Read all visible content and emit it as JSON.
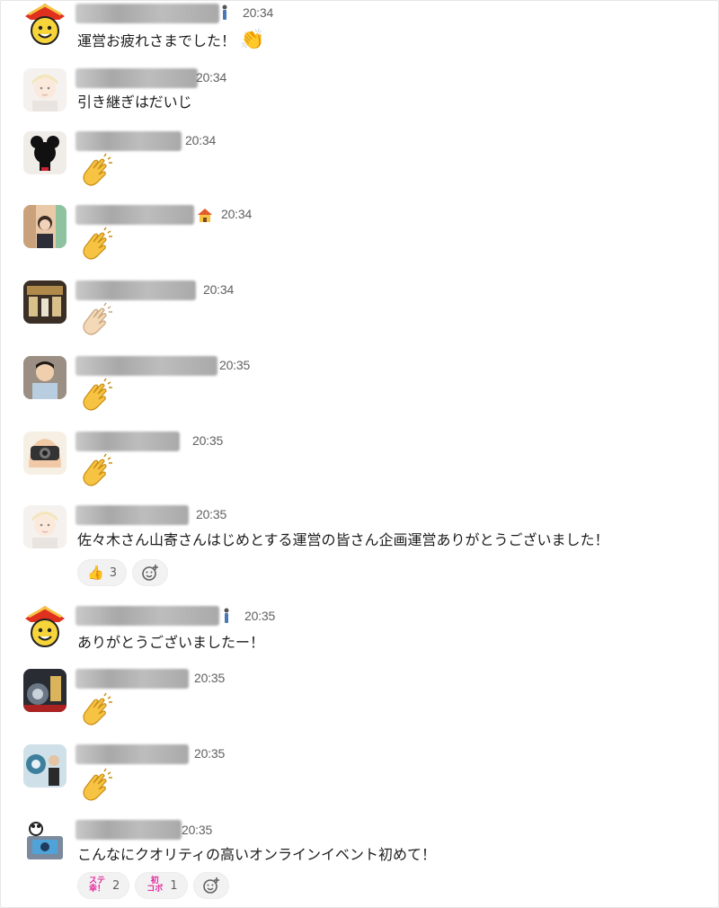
{
  "messages": [
    {
      "time": "20:34",
      "text": "運営お疲れさまでした！",
      "badge": "person-standing-icon"
    },
    {
      "time": "20:34",
      "text": "引き継ぎはだいじ"
    },
    {
      "time": "20:34",
      "emoji": "clap"
    },
    {
      "time": "20:34",
      "emoji": "clap",
      "badge": "house-icon"
    },
    {
      "time": "20:34",
      "emoji": "clap-light"
    },
    {
      "time": "20:35",
      "emoji": "clap"
    },
    {
      "time": "20:35",
      "emoji": "clap"
    },
    {
      "time": "20:35",
      "text": "佐々木さん山寄さんはじめとする運営の皆さん企画運営ありがとうございました！",
      "reactions": [
        {
          "icon": "thumbs-up-icon",
          "emoji": "👍",
          "count": "3"
        }
      ]
    },
    {
      "time": "20:35",
      "text": "ありがとうございましたー！",
      "badge": "person-standing-icon"
    },
    {
      "time": "20:35",
      "emoji": "clap"
    },
    {
      "time": "20:35",
      "emoji": "clap"
    },
    {
      "time": "20:35",
      "text": "こんなにクオリティの高いオンラインイベント初めて！",
      "reactions": [
        {
          "icon": "custom-stamp-icon",
          "stamp_text": "ステ\n幸！",
          "count": "2"
        },
        {
          "icon": "custom-stamp-icon",
          "stamp_text": "初\nコボ",
          "count": "1"
        }
      ]
    }
  ],
  "colors": {
    "clap": "#f6c342",
    "clap_light": "#f3d9b8",
    "timestamp": "#616061",
    "text": "#1d1c1d"
  }
}
